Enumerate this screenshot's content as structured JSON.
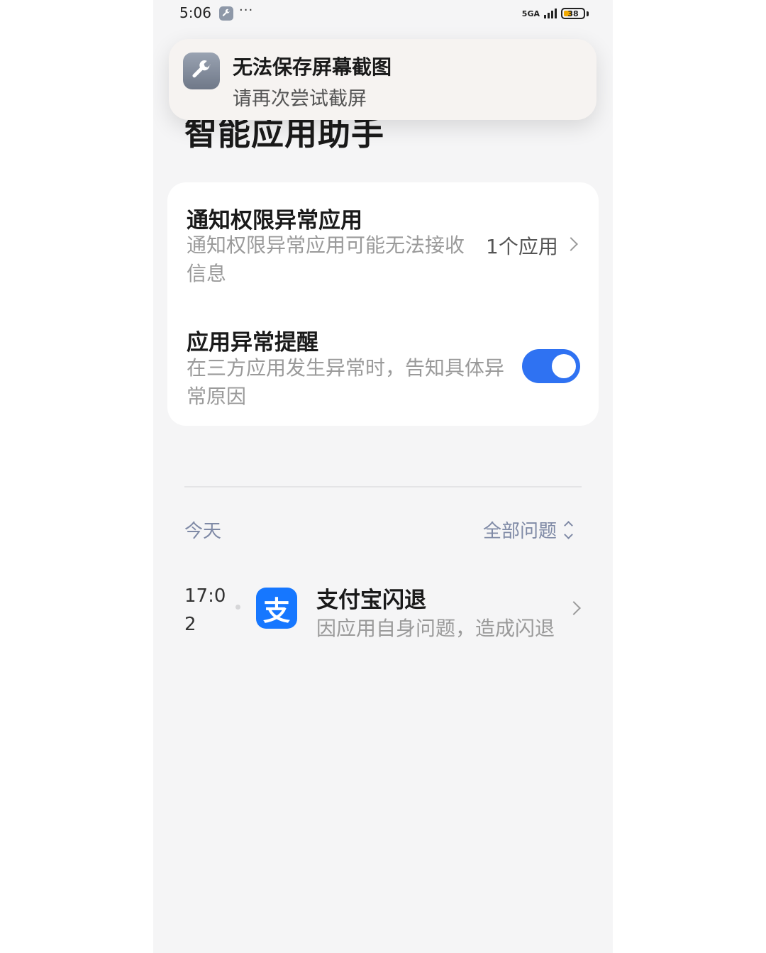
{
  "status_bar": {
    "time": "5:06",
    "more": "···",
    "network": "5GA",
    "battery": "38",
    "wrench_icon": "wrench-icon"
  },
  "toast": {
    "title": "无法保存屏幕截图",
    "subtitle": "请再次尝试截屏",
    "icon": "wrench-icon"
  },
  "page": {
    "title": "智能应用助手"
  },
  "settings_card": {
    "notify_permission": {
      "title": "通知权限异常应用",
      "description": "通知权限异常应用可能无法接收信息",
      "value": "1个应用"
    },
    "app_exception_alert": {
      "title": "应用异常提醒",
      "description": "在三方应用发生异常时，告知具体异常原因",
      "toggle_on": true
    }
  },
  "history": {
    "section_label": "今天",
    "filter_label": "全部问题",
    "events": [
      {
        "time": "17:02",
        "app_icon_glyph": "支",
        "title": "支付宝闪退",
        "description": "因应用自身问题，造成闪退"
      }
    ]
  },
  "colors": {
    "accent": "#2f72f2",
    "alipay": "#1677ff",
    "muted_label": "#7f8aa6"
  }
}
